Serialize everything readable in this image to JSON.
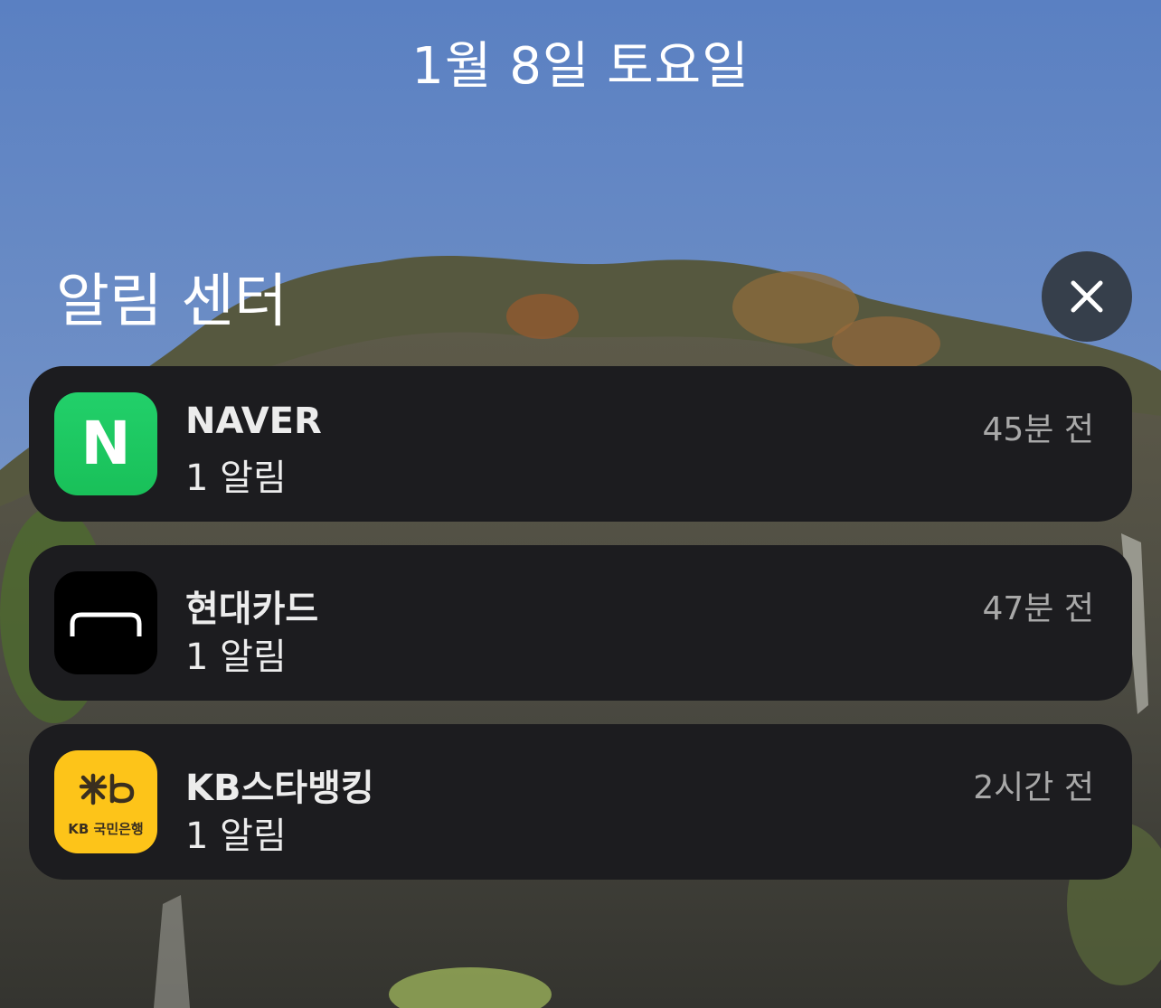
{
  "date": "1월 8일 토요일",
  "notification_center": {
    "title": "알림 센터",
    "close_icon": "close-icon"
  },
  "notifications": [
    {
      "app": "NAVER",
      "icon": "naver-app-icon",
      "icon_letter": "N",
      "count_text": "1 알림",
      "time": "45분 전"
    },
    {
      "app": "현대카드",
      "icon": "hyundai-card-app-icon",
      "count_text": "1 알림",
      "time": "47분 전"
    },
    {
      "app": "KB스타뱅킹",
      "icon": "kb-star-banking-app-icon",
      "icon_caption": "KB 국민은행",
      "count_text": "1 알림",
      "time": "2시간 전"
    }
  ],
  "colors": {
    "card_background": "#1c1c1f",
    "naver_green": "#1ec962",
    "kb_yellow": "#fdc419",
    "time_text": "#a8a8a8"
  }
}
